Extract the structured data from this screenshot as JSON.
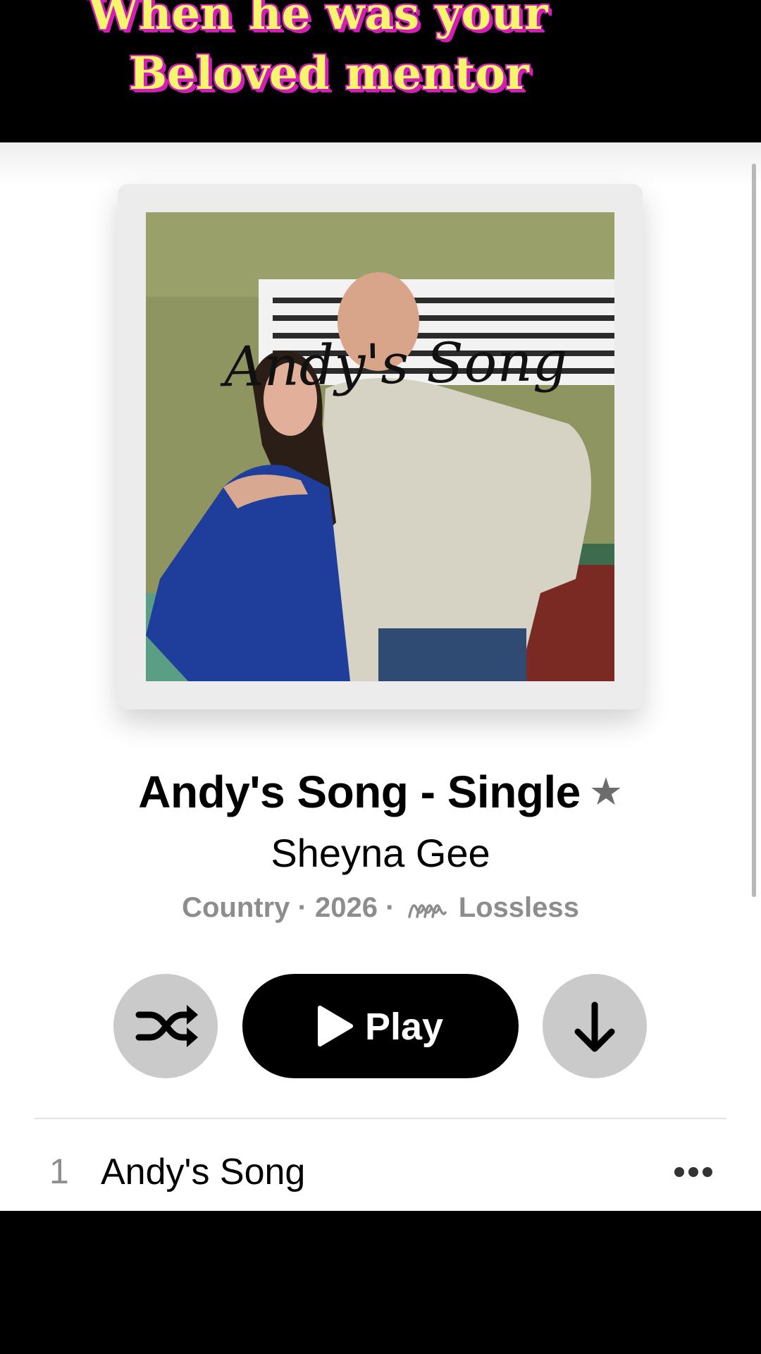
{
  "caption": {
    "line1": "When  he was your",
    "line2": "Beloved mentor"
  },
  "artwork": {
    "handwritten_text": "Andy's Song"
  },
  "album": {
    "title": "Andy's Song - Single",
    "artist": "Sheyna Gee",
    "genre": "Country",
    "separator": "·",
    "year": "2026",
    "quality": "Lossless",
    "badge_icon": "star-icon"
  },
  "controls": {
    "shuffle_icon": "shuffle-icon",
    "play_label": "Play",
    "download_icon": "download-icon"
  },
  "tracks": [
    {
      "number": "1",
      "title": "Andy's Song"
    }
  ],
  "colors": {
    "caption_text": "#f7f56c",
    "caption_outline": "#d11fb8",
    "meta_gray": "#8d8d8d",
    "button_gray": "#cacaca"
  }
}
